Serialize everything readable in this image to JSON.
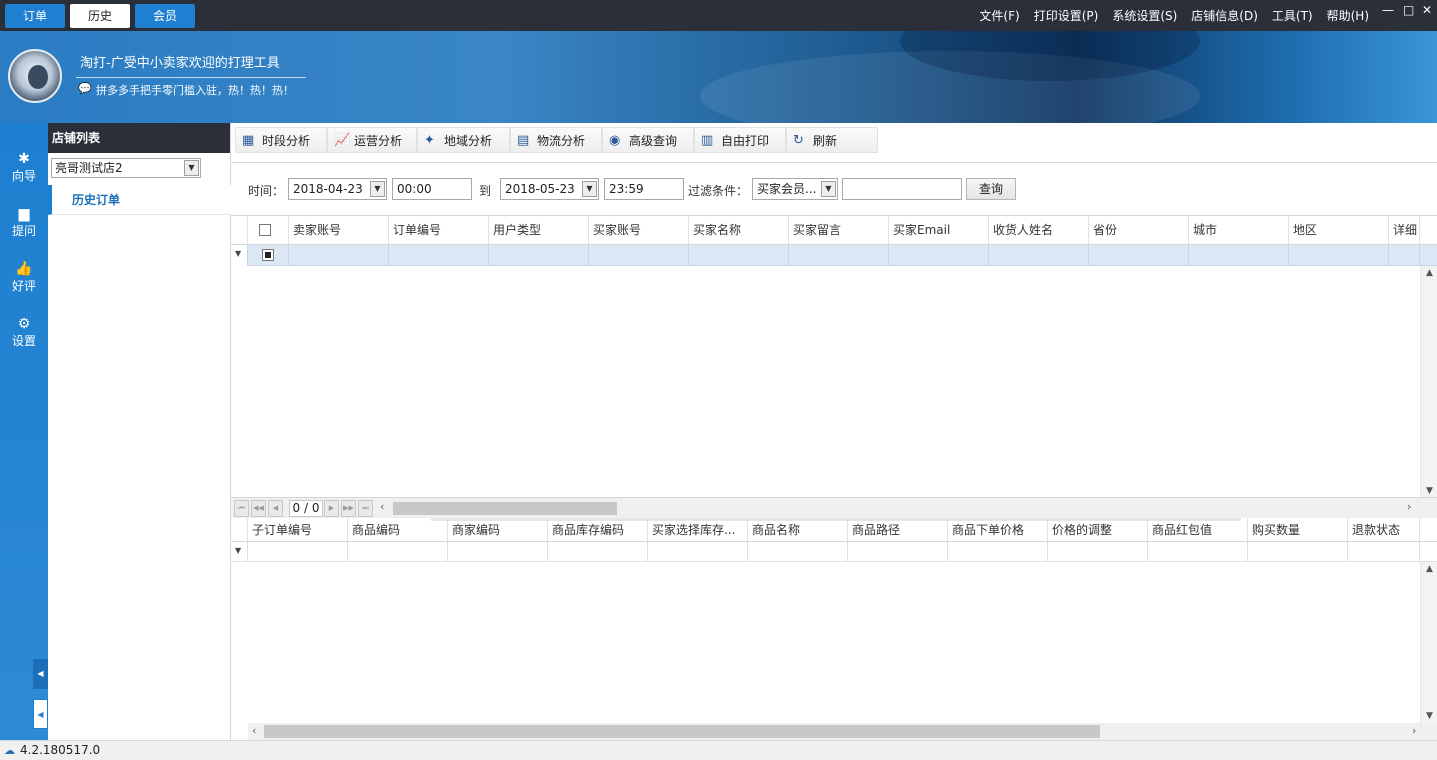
{
  "top_tabs": [
    "订单",
    "历史",
    "会员"
  ],
  "menu": [
    "文件(F)",
    "打印设置(P)",
    "系统设置(S)",
    "店铺信息(D)",
    "工具(T)",
    "帮助(H)"
  ],
  "window_controls": [
    "—",
    "□",
    "✕"
  ],
  "banner": {
    "title": "淘打-广受中小卖家欢迎的打理工具",
    "subtitle": "拼多多手把手零门槛入驻，热！热！热！"
  },
  "left_nav": [
    {
      "label": "向导",
      "icon": "wand-icon"
    },
    {
      "label": "提问",
      "icon": "question-icon"
    },
    {
      "label": "好评",
      "icon": "thumbs-up-icon"
    },
    {
      "label": "设置",
      "icon": "gear-icon"
    }
  ],
  "shop_panel": {
    "heading": "店铺列表",
    "selected_shop": "亮哥测试店2",
    "item": "历史订单"
  },
  "toolbar": [
    "时段分析",
    "运营分析",
    "地域分析",
    "物流分析",
    "高级查询",
    "自由打印",
    "刷新"
  ],
  "filter": {
    "time_label": "时间：",
    "start_date": "2018-04-23",
    "start_time": "00:00",
    "to_label": "到",
    "end_date": "2018-05-23",
    "end_time": "23:59",
    "condition_label": "过滤条件：",
    "condition_value": "买家会员...",
    "keyword": "",
    "query_label": "查询"
  },
  "order_grid": {
    "columns": [
      "卖家账号",
      "订单编号",
      "用户类型",
      "买家账号",
      "买家名称",
      "买家留言",
      "买家Email",
      "收货人姓名",
      "省份",
      "城市",
      "地区",
      "详细"
    ]
  },
  "pager": {
    "text": "0 / 0"
  },
  "item_grid": {
    "columns": [
      "子订单编号",
      "商品编码",
      "商家编码",
      "商品库存编码",
      "买家选择库存...",
      "商品名称",
      "商品路径",
      "商品下单价格",
      "价格的调整",
      "商品红包值",
      "购买数量",
      "退款状态"
    ]
  },
  "status": {
    "version": "4.2.180517.0"
  }
}
